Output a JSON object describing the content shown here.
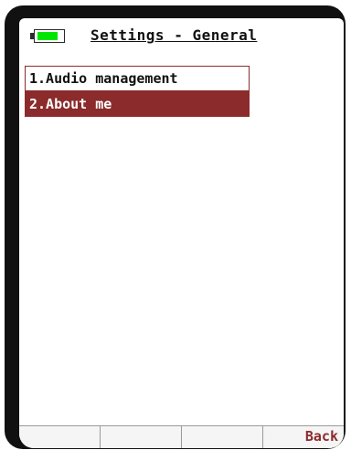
{
  "header": {
    "title": "Settings - General",
    "battery": {
      "level": 0.85,
      "fill_color": "#00e500"
    }
  },
  "menu": {
    "items": [
      {
        "label": "1.Audio management",
        "selected": false
      },
      {
        "label": "2.About me",
        "selected": true
      }
    ],
    "selected_color": "#8b2b2b"
  },
  "softkeys": {
    "keys": [
      "",
      "",
      "",
      "Back"
    ]
  }
}
